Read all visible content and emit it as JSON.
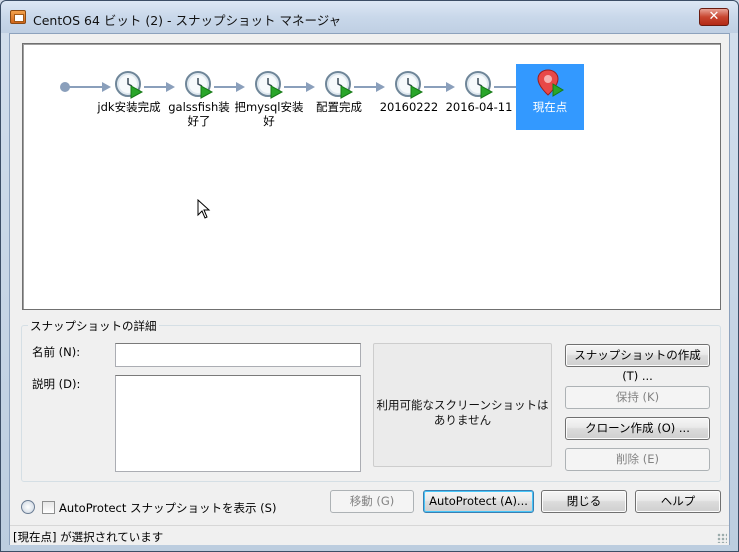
{
  "window": {
    "title": "CentOS 64 ビット (2) - スナップショット マネージャ",
    "close_glyph": "✕"
  },
  "timeline": {
    "snapshots": [
      {
        "label": "jdk安装完成"
      },
      {
        "label": "galssfish装好了"
      },
      {
        "label": "把mysql安装好"
      },
      {
        "label": "配置完成"
      },
      {
        "label": "20160222"
      },
      {
        "label": "2016-04-11"
      }
    ],
    "current": {
      "label": "現在点"
    }
  },
  "details": {
    "legend": "スナップショットの詳細",
    "name_label": "名前 (N):",
    "name_value": "",
    "desc_label": "説明 (D):",
    "desc_value": "",
    "preview_text": "利用可能なスクリーンショットは\nありません"
  },
  "buttons": {
    "take_snapshot": "スナップショットの作成 (T) ...",
    "keep": "保持 (K)",
    "clone": "クローン作成 (O) ...",
    "delete": "削除 (E)",
    "go_to": "移動 (G)",
    "autoprotect": "AutoProtect (A)...",
    "close": "閉じる",
    "help": "ヘルプ"
  },
  "footer": {
    "show_autoprotect_label": "AutoProtect スナップショットを表示 (S)",
    "show_autoprotect_checked": false
  },
  "status": {
    "text": "[現在点] が選択されています"
  },
  "colors": {
    "selection": "#3399ff",
    "timeline_line": "#8a9fbb"
  }
}
